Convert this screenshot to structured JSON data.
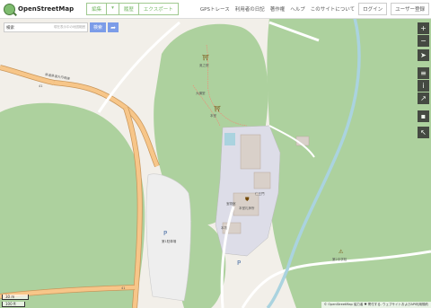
{
  "header": {
    "logo_text": "OpenStreetMap",
    "edit_label": "編集",
    "edit_dropdown_label": "▾",
    "history_label": "履歴",
    "export_label": "エクスポート",
    "nav": {
      "gps": "GPSトレース",
      "diary": "利用者の日記",
      "copyright": "著作権",
      "help": "ヘルプ",
      "about": "このサイトについて"
    },
    "login_label": "ログイン",
    "signup_label": "ユーザー登録"
  },
  "search": {
    "value": "検索",
    "hint": "現在表示中の地図範囲",
    "go_label": "検索",
    "directions_icon": "directions-arrow-icon"
  },
  "controls": [
    {
      "name": "zoom-in-button",
      "glyph": "+"
    },
    {
      "name": "zoom-out-button",
      "glyph": "−"
    },
    {
      "name": "locate-button",
      "glyph": "➤"
    },
    {
      "name": "layers-button",
      "glyph": "≡"
    },
    {
      "name": "legend-button",
      "glyph": "i"
    },
    {
      "name": "share-button",
      "glyph": "↗"
    },
    {
      "name": "note-button",
      "glyph": "▪"
    },
    {
      "name": "query-button",
      "glyph": "↖"
    }
  ],
  "scale": {
    "metric": "30 m",
    "imperial": "100 ft"
  },
  "attribution": "© OpenStreetMap 協力者 ♥ 寄付する. ウェブサイトおよびAPI利用規約",
  "map_labels": {
    "road_main": "県道県道大丹荷線",
    "road_number": "41",
    "parking": "P",
    "parking2": "P",
    "parking_name": "第1駐車場",
    "shrine1": "奥之院",
    "shrine2": "本坊",
    "temple_main": "本堂",
    "school": "第2中学校",
    "facility": "宝物館",
    "hall": "本堂礼拝所",
    "small1": "大講堂",
    "small2": "仁王門"
  },
  "colors": {
    "forest": "#add19e",
    "road_orange": "#f7c689",
    "road_border": "#c9965a",
    "water": "#aad3df",
    "building": "#d9d0c9",
    "landuse_gray": "#dddde8",
    "background": "#f2efe9"
  }
}
